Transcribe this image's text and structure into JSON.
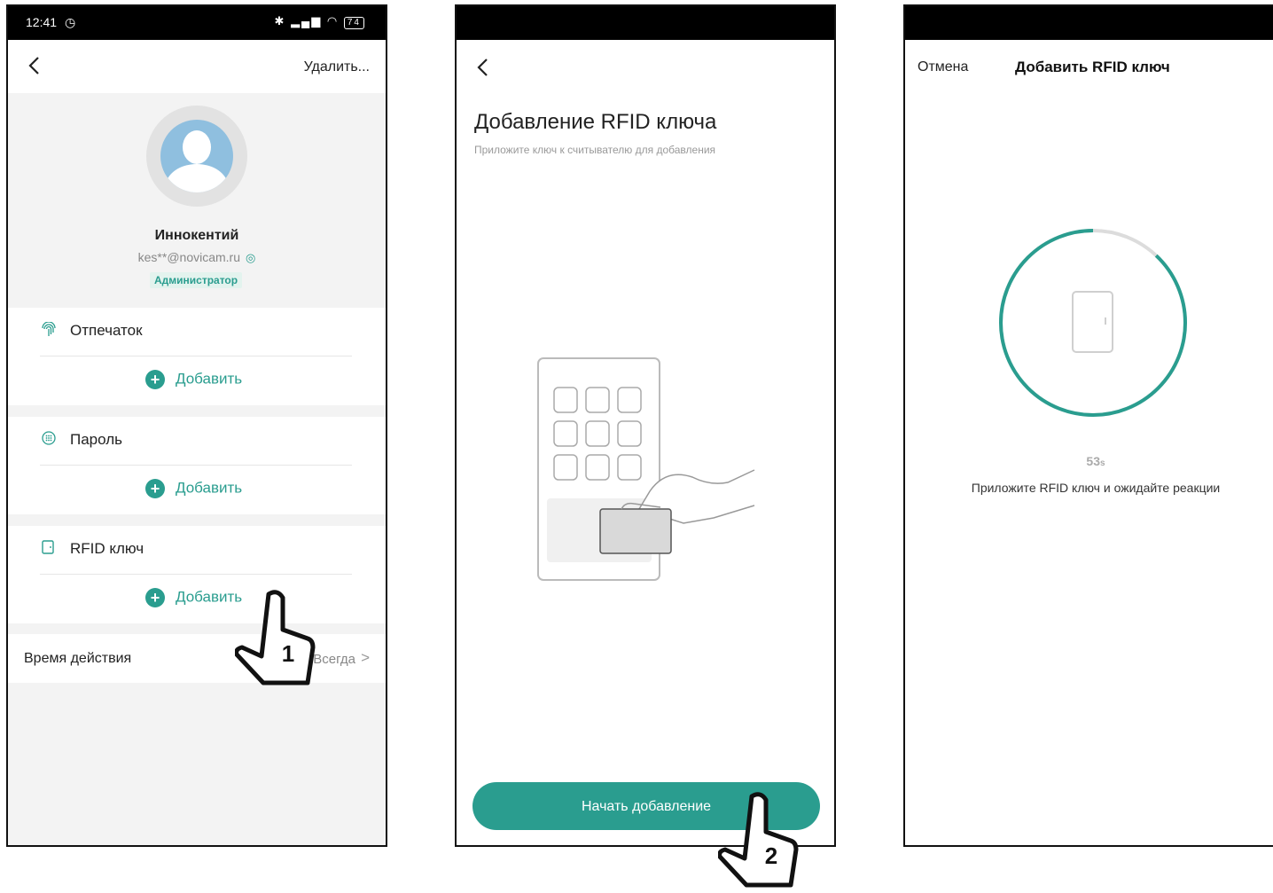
{
  "screen1": {
    "status": {
      "time": "12:41",
      "battery": "74"
    },
    "delete_label": "Удалить...",
    "user": {
      "name": "Иннокентий",
      "email": "kes**@novicam.ru",
      "role": "Администратор"
    },
    "sections": [
      {
        "label": "Отпечаток",
        "icon": "fingerprint-icon",
        "add_label": "Добавить"
      },
      {
        "label": "Пароль",
        "icon": "keypad-icon",
        "add_label": "Добавить"
      },
      {
        "label": "RFID ключ",
        "icon": "rfid-card-icon",
        "add_label": "Добавить"
      }
    ],
    "validity": {
      "label": "Время действия",
      "value": "Всегда"
    },
    "step_marker": "1"
  },
  "screen2": {
    "title": "Добавление RFID ключа",
    "subtitle": "Приложите ключ к считывателю для добавления",
    "start_button": "Начать добавление",
    "step_marker": "2"
  },
  "screen3": {
    "cancel_label": "Отмена",
    "title": "Добавить RFID ключ",
    "countdown_value": "53",
    "countdown_unit": "s",
    "countdown_progress": 0.88,
    "instruction": "Приложите RFID ключ и ожидайте реакции"
  },
  "colors": {
    "accent": "#2a9d8f",
    "badge_bg": "#e3f3ee"
  }
}
